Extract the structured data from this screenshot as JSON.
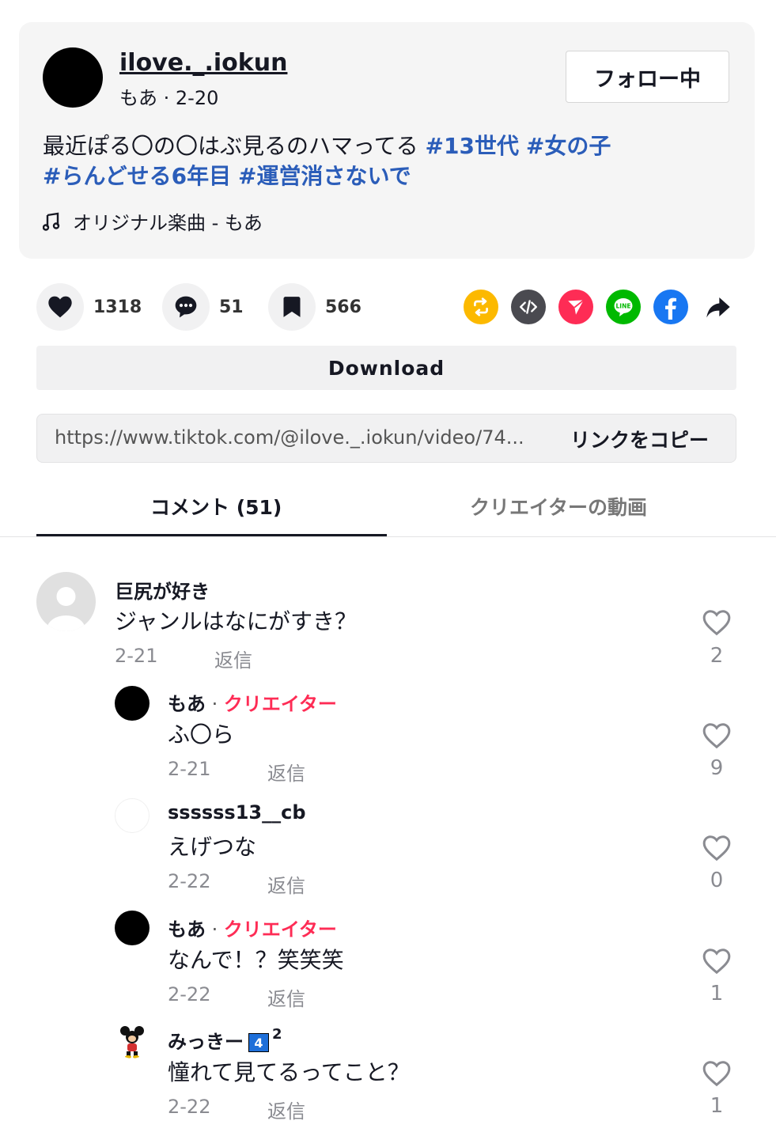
{
  "post": {
    "username": "ilove._.iokun",
    "nickname_date": "もあ · 2-20",
    "follow_label": "フォロー中",
    "description_text": "最近ぽる〇の〇はぶ見るのハマってる ",
    "hashtags": [
      "#13世代",
      "#女の子",
      "#らんどせる6年目",
      "#運営消さないで"
    ],
    "music": "オリジナル楽曲 - もあ"
  },
  "actions": {
    "likes": "1318",
    "comments": "51",
    "saves": "566"
  },
  "colors": {
    "repost": "#fcb900",
    "embed": "#4a4a50",
    "send": "#fe2c55",
    "line": "#00b900",
    "facebook": "#1877f2",
    "creator": "#fe2c55",
    "hashtag": "#2b5db9"
  },
  "download_label": "Download",
  "link": {
    "url": "https://www.tiktok.com/@ilove._.iokun/video/74...",
    "copy_label": "リンクをコピー"
  },
  "tabs": {
    "comments": "コメント (51)",
    "creator_videos": "クリエイターの動画"
  },
  "comments": [
    {
      "name": "巨尻が好き",
      "text": "ジャンルはなにがすき？",
      "date": "2-21",
      "reply": "返信",
      "likes": "2"
    },
    {
      "name": "もあ",
      "sep": " · ",
      "role": "クリエイター",
      "text": "ふ〇ら",
      "date": "2-21",
      "reply": "返信",
      "likes": "9"
    },
    {
      "name": "ssssss13__cb",
      "text": "えげつな",
      "date": "2-22",
      "reply": "返信",
      "likes": "0"
    },
    {
      "name": "もあ",
      "sep": " · ",
      "role": "クリエイター",
      "text": "なんで！？笑笑笑",
      "date": "2-22",
      "reply": "返信",
      "likes": "1"
    },
    {
      "name": "みっきー",
      "badge": "4",
      "sup": "2",
      "text": "憧れて見てるってこと？",
      "date": "2-22",
      "reply": "返信",
      "likes": "1"
    }
  ]
}
